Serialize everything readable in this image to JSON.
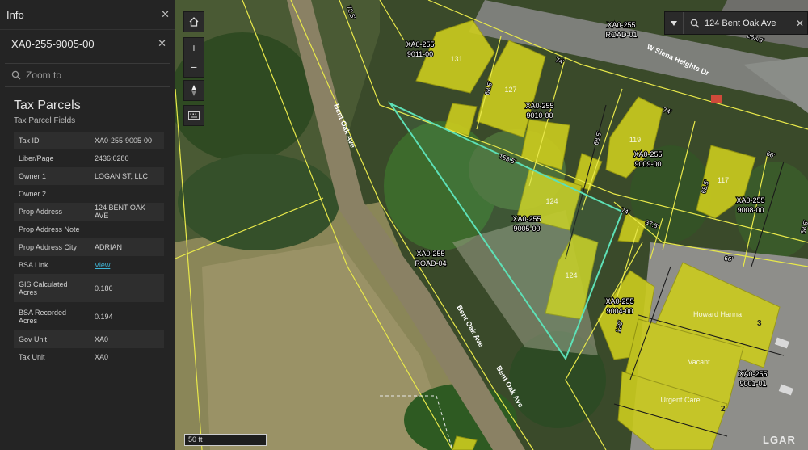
{
  "panel": {
    "title": "Info",
    "feature_id": "XA0-255-9005-00",
    "zoom_to": "Zoom to",
    "section_title": "Tax Parcels",
    "section_sub": "Tax Parcel Fields",
    "fields": [
      {
        "label": "Tax ID",
        "value": "XA0-255-9005-00"
      },
      {
        "label": "Liber/Page",
        "value": "2436:0280"
      },
      {
        "label": "Owner 1",
        "value": "LOGAN ST, LLC"
      },
      {
        "label": "Owner 2",
        "value": ""
      },
      {
        "label": "Prop Address",
        "value": "124 BENT OAK AVE"
      },
      {
        "label": "Prop Address Note",
        "value": ""
      },
      {
        "label": "Prop Address City",
        "value": "ADRIAN"
      },
      {
        "label": "BSA Link",
        "value": "View"
      },
      {
        "label": "GIS Calculated Acres",
        "value": "0.186"
      },
      {
        "label": "BSA Recorded Acres",
        "value": "0.194"
      },
      {
        "label": "Gov Unit",
        "value": "XA0"
      },
      {
        "label": "Tax Unit",
        "value": "XA0"
      }
    ]
  },
  "search": {
    "value": "124 Bent Oak Ave"
  },
  "scale": {
    "label": "50 ft"
  },
  "logo": "LGAR",
  "map": {
    "parcel_labels": [
      {
        "line1": "XA0-255",
        "line2": "9011-00"
      },
      {
        "line1": "XA0-255",
        "line2": "9010-00"
      },
      {
        "line1": "XA0-255",
        "line2": "9009-00"
      },
      {
        "line1": "XA0-255",
        "line2": "9008-00"
      },
      {
        "line1": "XA0-255",
        "line2": "9005-00"
      },
      {
        "line1": "XA0-255",
        "line2": "9004-00"
      },
      {
        "line1": "XA0-255",
        "line2": "9001-01"
      },
      {
        "line1": "XA0-255",
        "line2": "ROAD-01"
      },
      {
        "line1": "XA0-255",
        "line2": "ROAD-04"
      }
    ],
    "street_labels": [
      "Bent Oak Ave",
      "Bent Oak Ave",
      "Bent Oak Ave",
      "W Siena Heights Dr"
    ],
    "dimension_labels": [
      "74'",
      "74'",
      "66'",
      "153.5'",
      "74'",
      "37.5'",
      "66'",
      "120'",
      "68.5'",
      "68.5'",
      "68.5'",
      "68.5'",
      "263.9'",
      "72.5'"
    ],
    "house_numbers": [
      "131",
      "127",
      "119",
      "117",
      "124",
      "124"
    ],
    "business_labels": [
      "Howard Hanna",
      "Vacant",
      "Urgent Care"
    ],
    "unit_numbers": [
      "3",
      "2"
    ],
    "colors": {
      "building": "#cccc1e",
      "parcel_line": "#e8e84a",
      "selected": "#5de0b6"
    }
  }
}
